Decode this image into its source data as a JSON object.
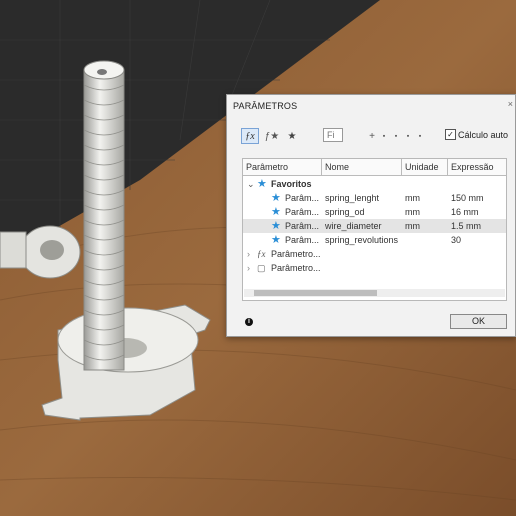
{
  "dialog": {
    "title": "PARÂMETROS",
    "close_glyph": "×",
    "filter_placeholder": "Fi",
    "auto_calc_label": "Cálculo auto",
    "auto_calc_checked": true,
    "ok_label": "OK",
    "columns": [
      "Parâmetro",
      "Nome",
      "Unidade",
      "Expressão"
    ],
    "favorites_group": "Favoritos",
    "favorites": [
      {
        "param": "Parâm...",
        "name": "spring_lenght",
        "unit": "mm",
        "expr": "150 mm"
      },
      {
        "param": "Parâm...",
        "name": "spring_od",
        "unit": "mm",
        "expr": "16 mm"
      },
      {
        "param": "Parâm...",
        "name": "wire_diameter",
        "unit": "mm",
        "expr": "1.5 mm"
      },
      {
        "param": "Parâm...",
        "name": "spring_revolutions",
        "unit": "",
        "expr": "30"
      }
    ],
    "groups": [
      "Parâmetro...",
      "Parâmetro..."
    ]
  },
  "colors": {
    "accent": "#2a8ed6",
    "selected_row": "#e4e4e4"
  }
}
